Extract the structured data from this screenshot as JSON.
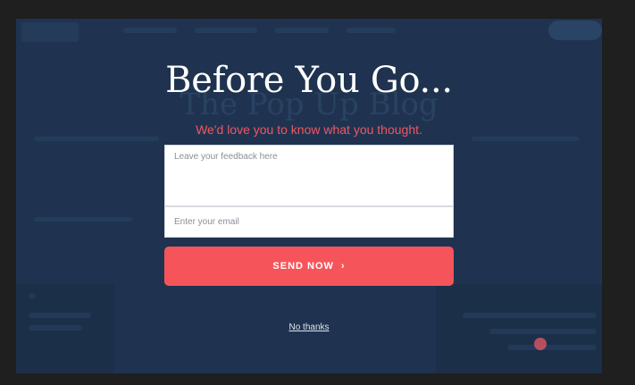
{
  "popup": {
    "headline": "Before You Go...",
    "subline": "We'd love you to know what you thought.",
    "feedback_placeholder": "Leave your feedback here",
    "email_placeholder": "Enter your email",
    "send_label": "SEND NOW",
    "send_icon": "chevron-right-icon",
    "no_thanks_label": "No thanks"
  },
  "background": {
    "blog_title": "The Pop Up Blog"
  },
  "colors": {
    "overlay": "#1f3350",
    "accent": "#f5555a",
    "subline": "#f25562"
  }
}
